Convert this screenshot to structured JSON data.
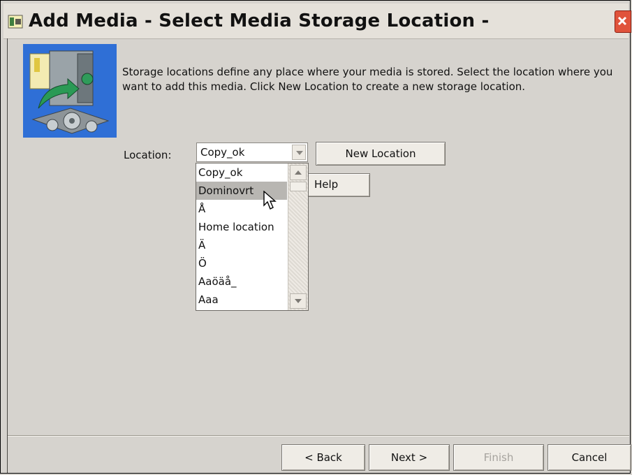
{
  "window": {
    "title": "Add Media - Select Media Storage Location -"
  },
  "intro_text": "Storage locations define any place where your media is stored.  Select the location where you want to add this media.  Click New Location to create a new storage location.",
  "location": {
    "label": "Location:",
    "selected_value": "Copy_ok",
    "new_location_label": "New Location",
    "help_label": "Help",
    "dropdown_items": [
      "Copy_ok",
      "Dominovrt",
      "Å",
      "Home location",
      "Ä",
      "Ö",
      "Aaöäå_",
      "Aaa"
    ],
    "highlighted_item": "Dominovrt"
  },
  "footer": {
    "back_label": "< Back",
    "next_label": "Next >",
    "finish_label": "Finish",
    "cancel_label": "Cancel"
  },
  "colors": {
    "dialog_bg": "#d6d3ce",
    "close_button": "#e0533b",
    "highlight": "#b8b6b2",
    "disabled_text": "#a6a39e"
  },
  "icons": {
    "app": "wizard-app-icon",
    "hero": "media-safe-icon",
    "close": "close-icon",
    "cursor": "mouse-pointer-icon"
  }
}
